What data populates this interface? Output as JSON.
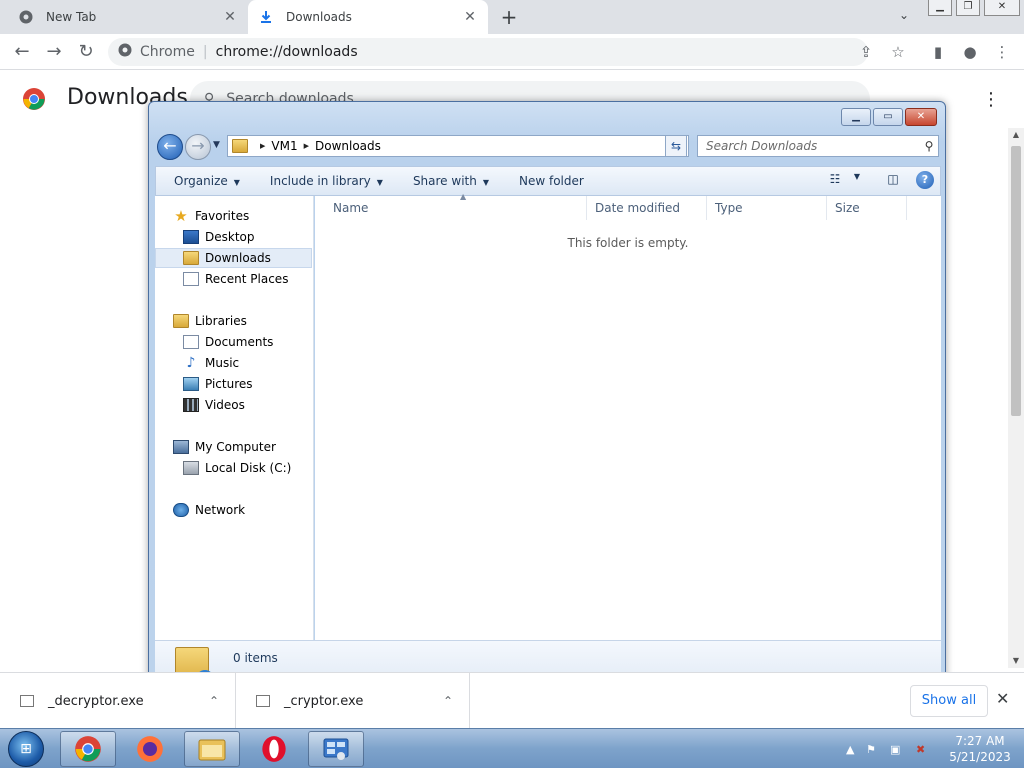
{
  "browser": {
    "tabs": [
      {
        "title": "New Tab",
        "active": false
      },
      {
        "title": "Downloads",
        "active": true
      }
    ],
    "omnibox": {
      "site": "Chrome",
      "url": "chrome://downloads"
    }
  },
  "downloads_page": {
    "title": "Downloads",
    "search_placeholder": "Search downloads"
  },
  "explorer": {
    "breadcrumb": [
      "VM1",
      "Downloads"
    ],
    "search_placeholder": "Search Downloads",
    "commands": [
      "Organize",
      "Include in library",
      "Share with",
      "New folder"
    ],
    "nav": {
      "favorites": "Favorites",
      "desktop": "Desktop",
      "downloads": "Downloads",
      "recent": "Recent Places",
      "libraries": "Libraries",
      "documents": "Documents",
      "music": "Music",
      "pictures": "Pictures",
      "videos": "Videos",
      "computer": "My Computer",
      "local_disk": "Local Disk (C:)",
      "network": "Network"
    },
    "columns": [
      "Name",
      "Date modified",
      "Type",
      "Size"
    ],
    "empty_message": "This folder is empty.",
    "status": "0 items"
  },
  "shelf": {
    "items": [
      "_decryptor.exe",
      "_cryptor.exe"
    ],
    "show_all": "Show all"
  },
  "taskbar": {
    "time": "7:27 AM",
    "date": "5/21/2023"
  },
  "colors": {
    "chrome_tabstrip": "#dee1e6",
    "accent_blue": "#1a73e8",
    "win7_taskbar": "#7ea3cb"
  }
}
